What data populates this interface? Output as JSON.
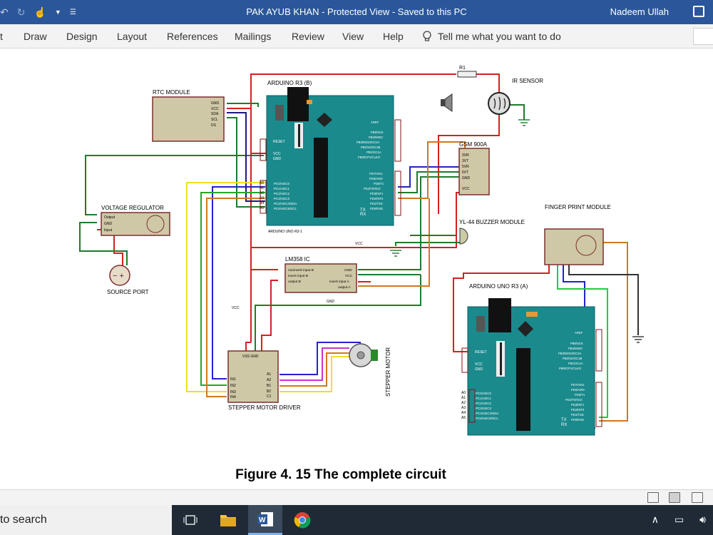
{
  "app": {
    "title_doc": "PAK AYUB KHAN",
    "title_sep1": " - ",
    "title_mode": "Protected View",
    "title_sep2": " - ",
    "title_saved": "Saved to this PC",
    "user": "Nadeem Ullah"
  },
  "ribbon": {
    "tabs": [
      "t",
      "Draw",
      "Design",
      "Layout",
      "References",
      "Mailings",
      "Review",
      "View",
      "Help"
    ],
    "tell_me": "Tell me what you want to do"
  },
  "figure": {
    "caption": "Figure 4. 15  The complete circuit",
    "labels": {
      "rtc": "RTC MODULE",
      "rtc_pins": [
        "GND",
        "VCC",
        "SDA",
        "SCL",
        "DS"
      ],
      "arduino_b": "ARDUINO R3 (B)",
      "arduino_b_sub": "ARDUINO UNO R3-1",
      "arduino_a": "ARDUINO UNO R3 (A)",
      "r1": "R1",
      "ir": "IR SENSOR",
      "gsm": "GSM 900A",
      "gsm_pins": [
        "3VR",
        "3VT",
        "5VR",
        "5VT",
        "GND",
        "VCC"
      ],
      "vreg": "VOLTAGE REGULATOR",
      "vreg_pins": [
        "Output",
        "GND",
        "Input"
      ],
      "source": "SOURCE PORT",
      "buzzer": "YL-44 BUZZER MODULE",
      "finger": "FINGER PRINT MODULE",
      "lm358": "LM358 IC",
      "lm_left": [
        "noninvert input B",
        "invert input B",
        "output B"
      ],
      "lm_right": [
        "GND",
        "VCC",
        "invert input A",
        "output A"
      ],
      "driver": "STEPPER MOTOR DRIVER",
      "driver_top": "VSS  GND",
      "driver_in": [
        "IN1",
        "IN2",
        "IN3",
        "IN4"
      ],
      "driver_out": [
        "A1",
        "A2",
        "B1",
        "B2",
        "C1"
      ],
      "motor": "STEPPER MOTOR",
      "vcc": "VCC",
      "gnd": "GND",
      "reset": "RESET",
      "analog_in": "ANALOG IN",
      "digital_pins": [
        "AREF",
        "PB5/SCK",
        "PB4/MISO",
        "PB3/MOSI/OC2A",
        "PB2/SS/OC1B",
        "PB1/OC1A",
        "PB0/ICP1/CLKO",
        "PD7/AIN1",
        "PD6/AIN0",
        "PD5/T1",
        "PD4/T0/XCK",
        "PD3/INT1",
        "PD2/INT0",
        "PD1/TXD",
        "PD0/RXD"
      ],
      "analog_pins": [
        "PC0/ADC0",
        "PC1/ADC1",
        "PC2/ADC2",
        "PC3/ADC3",
        "PC4/ADC4/SDA",
        "PC5/ADC5/SCL"
      ],
      "a_nums": [
        "A0",
        "A1",
        "A2",
        "A3",
        "A4",
        "A5"
      ],
      "tx": "TX",
      "rx": "RX",
      "on": "ON",
      "reset_btn": "Reset BTN"
    }
  },
  "taskbar": {
    "search": "to search"
  },
  "colors": {
    "titlebar": "#2b579a",
    "board": "#1a8a8c",
    "wire_red": "#d42020",
    "wire_green": "#1f7a2e",
    "wire_blue": "#2222cc",
    "wire_yellow": "#f0e020",
    "wire_orange": "#d07820",
    "wire_magenta": "#cc33cc"
  }
}
